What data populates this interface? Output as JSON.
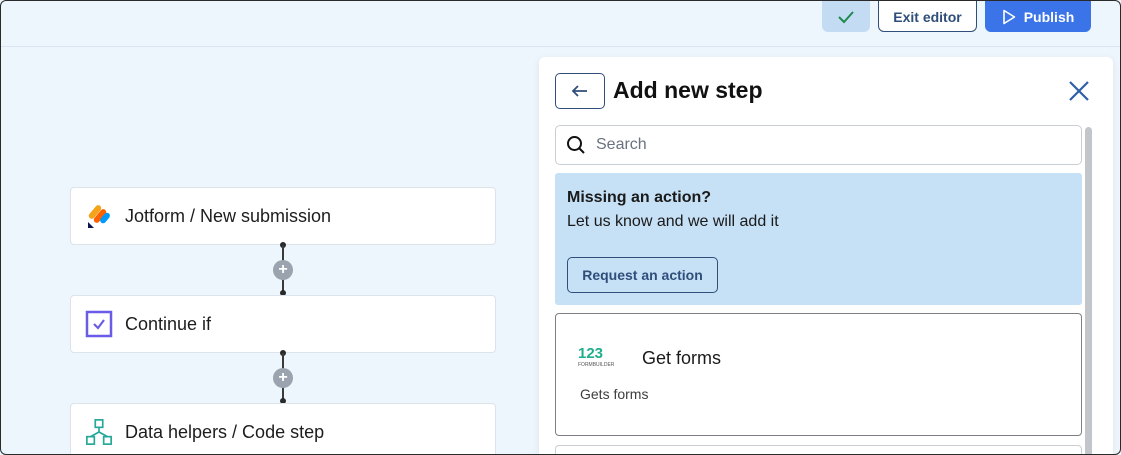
{
  "header": {
    "exit_label": "Exit editor",
    "publish_label": "Publish"
  },
  "flow": {
    "steps": [
      {
        "label": "Jotform / New submission",
        "icon": "jotform-icon"
      },
      {
        "label": "Continue if",
        "icon": "checkbox-icon"
      },
      {
        "label": "Data helpers / Code step",
        "icon": "hierarchy-icon"
      }
    ]
  },
  "panel": {
    "title": "Add new step",
    "search_placeholder": "Search",
    "missing": {
      "title": "Missing an action?",
      "subtitle": "Let us know and we will add it",
      "button": "Request an action"
    },
    "actions": [
      {
        "title": "Get forms",
        "description": "Gets forms",
        "logo_text": "123",
        "logo_sub": "FORMBUILDER"
      }
    ]
  },
  "colors": {
    "accent": "#3a74e8",
    "navy": "#2f4e7a",
    "banner": "#c6e0f6"
  }
}
